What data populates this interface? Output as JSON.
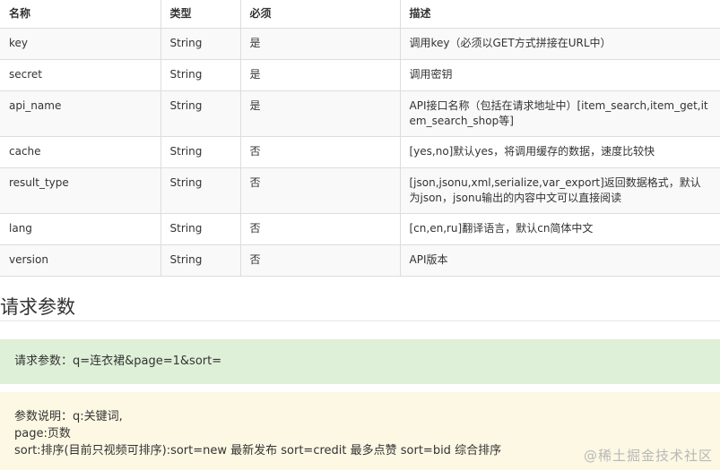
{
  "table": {
    "headers": [
      "名称",
      "类型",
      "必须",
      "描述"
    ],
    "rows": [
      {
        "name": "key",
        "type": "String",
        "required": "是",
        "desc": "调用key（必须以GET方式拼接在URL中）"
      },
      {
        "name": "secret",
        "type": "String",
        "required": "是",
        "desc": "调用密钥"
      },
      {
        "name": "api_name",
        "type": "String",
        "required": "是",
        "desc": "API接口名称（包括在请求地址中）[item_search,item_get,item_search_shop等]"
      },
      {
        "name": "cache",
        "type": "String",
        "required": "否",
        "desc": "[yes,no]默认yes，将调用缓存的数据，速度比较快"
      },
      {
        "name": "result_type",
        "type": "String",
        "required": "否",
        "desc": "[json,jsonu,xml,serialize,var_export]返回数据格式，默认为json，jsonu输出的内容中文可以直接阅读"
      },
      {
        "name": "lang",
        "type": "String",
        "required": "否",
        "desc": "[cn,en,ru]翻译语言，默认cn简体中文"
      },
      {
        "name": "version",
        "type": "String",
        "required": "否",
        "desc": "API版本"
      }
    ]
  },
  "section": {
    "title": "请求参数"
  },
  "request_box": {
    "text": "请求参数：q=连衣裙&page=1&sort="
  },
  "explain_box": {
    "lines": [
      "参数说明：q:关键词,",
      "page:页数",
      "sort:排序(目前只视频可排序):sort=new 最新发布 sort=credit 最多点赞 sort=bid 综合排序"
    ]
  },
  "watermark": {
    "text": "@稀土掘金技术社区"
  }
}
